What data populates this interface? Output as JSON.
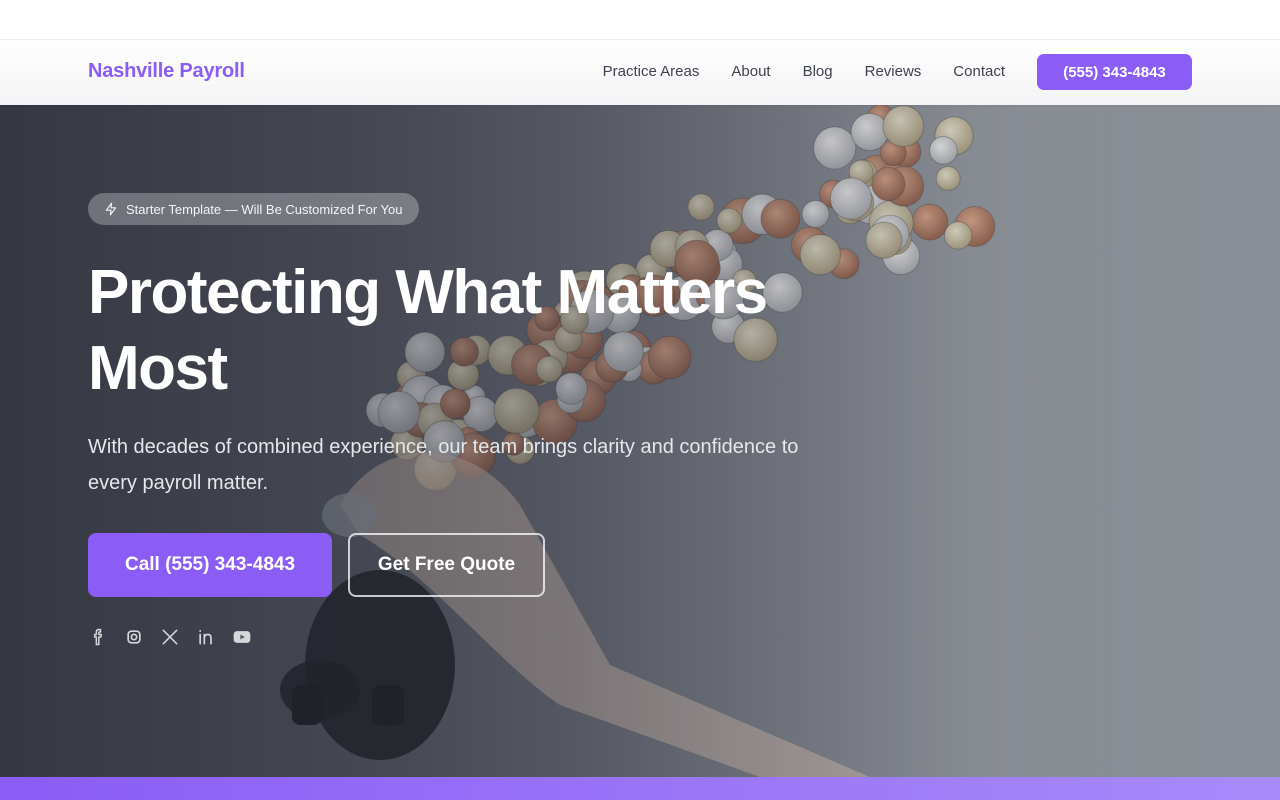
{
  "brand": {
    "name": "Nashville Payroll",
    "color": "#8b5cf6"
  },
  "nav": {
    "links": [
      "Practice Areas",
      "About",
      "Blog",
      "Reviews",
      "Contact"
    ],
    "cta_label": "(555) 343-4843"
  },
  "hero": {
    "badge": {
      "text": "Starter Template — Will Be Customized For You",
      "icon": "bolt-icon"
    },
    "title": "Protecting What Matters Most",
    "subtitle": "With decades of combined experience, our team brings clarity and confidence to every payroll matter.",
    "primary_button": "Call (555) 343-4843",
    "secondary_button": "Get Free Quote",
    "background_image": "piggy-bank-coins-photo",
    "socials": [
      "facebook-icon",
      "instagram-icon",
      "x-icon",
      "linkedin-icon",
      "youtube-icon"
    ]
  },
  "colors": {
    "accent": "#8b5cf6",
    "accent_light": "#a78bfa"
  }
}
